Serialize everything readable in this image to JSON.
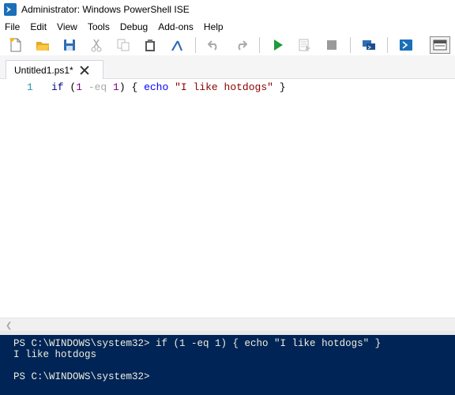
{
  "window": {
    "title": "Administrator: Windows PowerShell ISE",
    "icon": "powershell-ise-icon"
  },
  "menu": {
    "items": [
      "File",
      "Edit",
      "View",
      "Tools",
      "Debug",
      "Add-ons",
      "Help"
    ]
  },
  "toolbar": {
    "icons": [
      "new-file-icon",
      "open-folder-icon",
      "save-icon",
      "cut-icon",
      "copy-icon",
      "paste-icon",
      "clear-console-icon",
      "undo-icon",
      "redo-icon",
      "run-script-icon",
      "run-selection-icon",
      "stop-icon",
      "remote-powershell-icon",
      "powershell-console-icon",
      "show-script-pane-icon"
    ]
  },
  "tab": {
    "label": "Untitled1.ps1*"
  },
  "editor": {
    "line_number": "1",
    "tokens": {
      "if": "if",
      "open_paren": " (",
      "one_a": "1",
      "op": " -eq ",
      "one_b": "1",
      "close_paren_brace": ") { ",
      "cmd": "echo",
      "space": " ",
      "str": "\"I like hotdogs\"",
      "end": " }"
    }
  },
  "console": {
    "lines": [
      "PS C:\\WINDOWS\\system32> if (1 -eq 1) { echo \"I like hotdogs\" }",
      "I like hotdogs",
      "PS C:\\WINDOWS\\system32>"
    ]
  },
  "colors": {
    "console_bg": "#012456",
    "console_text": "#eeeedd",
    "keyword": "#00008b",
    "number": "#800080",
    "command": "#0000ff",
    "string": "#8b0000",
    "line_number": "#2b91af"
  }
}
